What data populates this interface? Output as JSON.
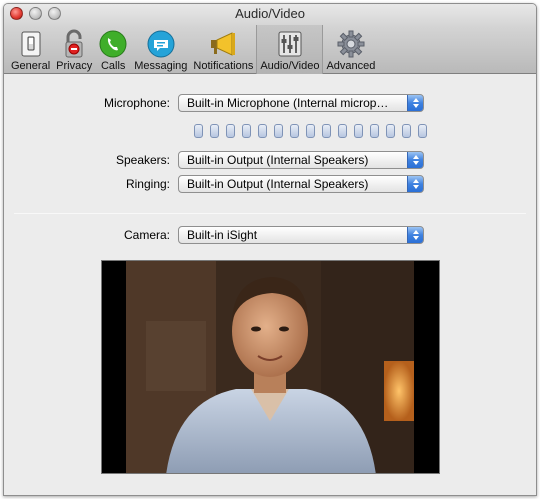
{
  "window": {
    "title": "Audio/Video"
  },
  "toolbar": {
    "items": [
      {
        "label": "General",
        "icon": "general-switch-icon"
      },
      {
        "label": "Privacy",
        "icon": "privacy-lock-icon"
      },
      {
        "label": "Calls",
        "icon": "phone-icon"
      },
      {
        "label": "Messaging",
        "icon": "chat-bubble-icon"
      },
      {
        "label": "Notifications",
        "icon": "megaphone-icon"
      },
      {
        "label": "Audio/Video",
        "icon": "mixer-sliders-icon",
        "selected": true
      },
      {
        "label": "Advanced",
        "icon": "gear-icon"
      }
    ]
  },
  "audio": {
    "microphone_label": "Microphone:",
    "microphone_value": "Built-in Microphone (Internal microp…",
    "input_level": 0.0,
    "speakers_label": "Speakers:",
    "speakers_value": "Built-in Output (Internal Speakers)",
    "ringing_label": "Ringing:",
    "ringing_value": "Built-in Output (Internal Speakers)"
  },
  "video": {
    "camera_label": "Camera:",
    "camera_value": "Built-in iSight"
  },
  "colors": {
    "accent": "#3f82e0",
    "close_button": "#e0382f"
  }
}
